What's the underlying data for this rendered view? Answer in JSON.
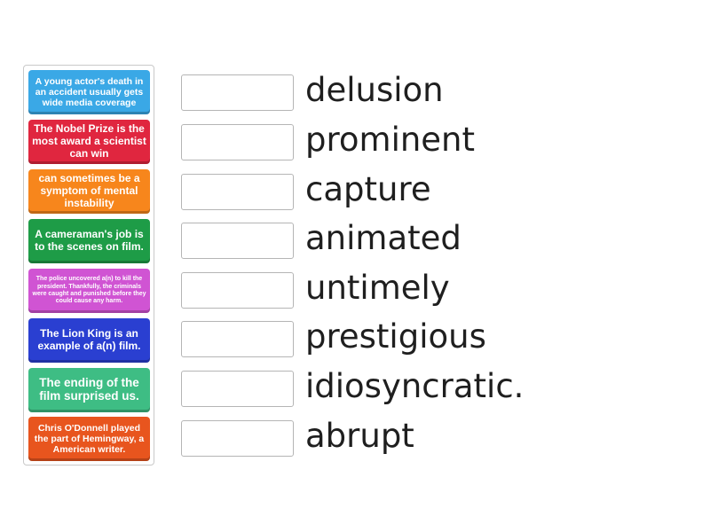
{
  "cards": [
    {
      "text": "A young actor's death in an accident usually gets wide media coverage",
      "color": "#3aa8e6"
    },
    {
      "text": "The Nobel Prize is the most award a scientist can win",
      "color": "#e0263f"
    },
    {
      "text": "can sometimes be a symptom of mental instability",
      "color": "#f7861c"
    },
    {
      "text": "A cameraman's job is to the scenes on film.",
      "color": "#1e9c47"
    },
    {
      "text": "The police uncovered a(n) to kill the president. Thankfully, the criminals were caught and punished before they could cause any harm.",
      "color": "#d054d3"
    },
    {
      "text": "The Lion King is an example of a(n) film.",
      "color": "#2a3fd1"
    },
    {
      "text": "The ending of the film surprised us.",
      "color": "#3ebd84"
    },
    {
      "text": "Chris O'Donnell played the part of Hemingway, a American writer.",
      "color": "#e8551e"
    }
  ],
  "words": [
    "delusion",
    "prominent",
    "capture",
    "animated",
    "untimely",
    "prestigious",
    "idiosyncratic.",
    "abrupt"
  ]
}
